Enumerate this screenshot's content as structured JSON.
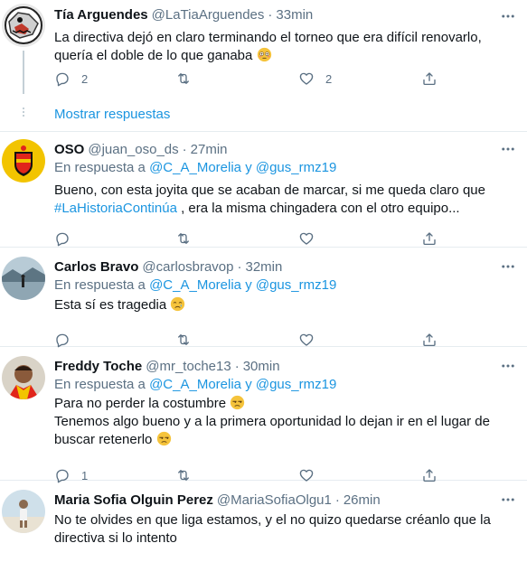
{
  "tweets": [
    {
      "name": "Tía Arguendes",
      "handle": "@LaTiaArguendes",
      "time": "33min",
      "text_line1": "La directiva dejó en claro terminando el torneo que era difícil renovarlo,",
      "text_line2": "quería el doble de lo que ganaba",
      "text_emoji": "😳",
      "reply_count": "2",
      "retweet_count": "",
      "like_count": "2"
    },
    {
      "name": "OSO",
      "handle": "@juan_oso_ds",
      "time": "27min",
      "reply_prefix": "En respuesta a",
      "reply_user1": "@C_A_Morelia",
      "reply_conj": "y",
      "reply_user2": "@gus_rmz19",
      "text_line1": "Bueno, con esta joyita que se acaban de marcar, si me queda claro que",
      "hashtag": "#LaHistoriaContinúa",
      "text_line2_rest": ", era la misma chingadera con el otro equipo..."
    },
    {
      "name": "Carlos Bravo",
      "handle": "@carlosbravop",
      "time": "32min",
      "reply_prefix": "En respuesta a",
      "reply_user1": "@C_A_Morelia",
      "reply_conj": "y",
      "reply_user2": "@gus_rmz19",
      "text_line1": "Esta sí es tragedia",
      "text_emoji": "😢"
    },
    {
      "name": "Freddy Toche",
      "handle": "@mr_toche13",
      "time": "30min",
      "reply_prefix": "En respuesta a",
      "reply_user1": "@C_A_Morelia",
      "reply_conj": "y",
      "reply_user2": "@gus_rmz19",
      "text_line1": "Para no perder la costumbre",
      "text_line2": "Tenemos algo bueno y a la primera oportunidad lo dejan ir en el lugar de",
      "text_line3": "buscar retenerlo",
      "text_emoji": "😒",
      "reply_count": "1"
    },
    {
      "name": "Maria Sofia Olguin Perez",
      "handle": "@MariaSofiaOlgu1",
      "time": "26min",
      "text_line1": "No te olvides en que liga estamos, y el no quizo quedarse créanlo que la",
      "text_line2": "directiva si lo intento"
    }
  ],
  "show_replies_label": "Mostrar respuestas",
  "header_separator": "·",
  "icons": [
    "more-icon",
    "reply-icon",
    "retweet-icon",
    "like-icon",
    "share-icon"
  ],
  "colors": {
    "link": "#1b95e0",
    "secondary": "#5b7083",
    "divider": "#e6ecf0",
    "text": "#0f1419"
  }
}
